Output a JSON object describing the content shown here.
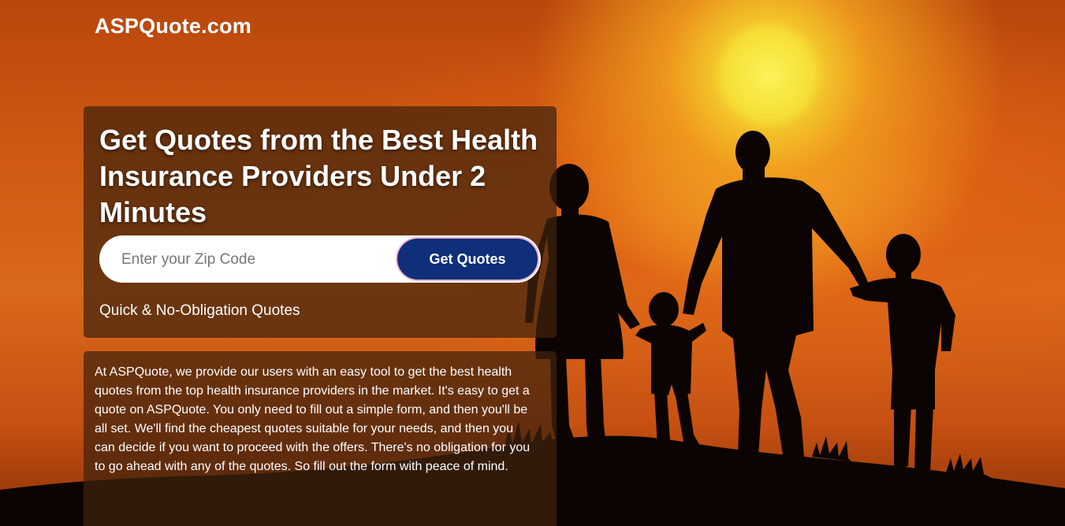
{
  "site": {
    "logo_text": "ASPQuote.com"
  },
  "hero": {
    "headline": "Get Quotes from the Best Health Insurance Providers Under 2 Minutes",
    "zip_placeholder": "Enter your Zip Code",
    "zip_value": "",
    "button_label": "Get Quotes",
    "tagline": "Quick & No-Obligation Quotes"
  },
  "info": {
    "paragraph": "At ASPQuote, we provide our users with an easy tool to get the best health quotes from the top health insurance providers in the market. It's easy to get a quote on ASPQuote. You only need to fill out a simple form, and then you'll be all set. We'll find the cheapest quotes suitable for your needs, and then you can decide if you want to proceed with the offers. There's no obligation for you to go ahead with any of the quotes. So fill out the form with peace of mind."
  },
  "colors": {
    "button": "#0f2f7a",
    "button_border": "#f1b8cf",
    "card_overlay": "#40220c",
    "sun": "#f6df35"
  }
}
